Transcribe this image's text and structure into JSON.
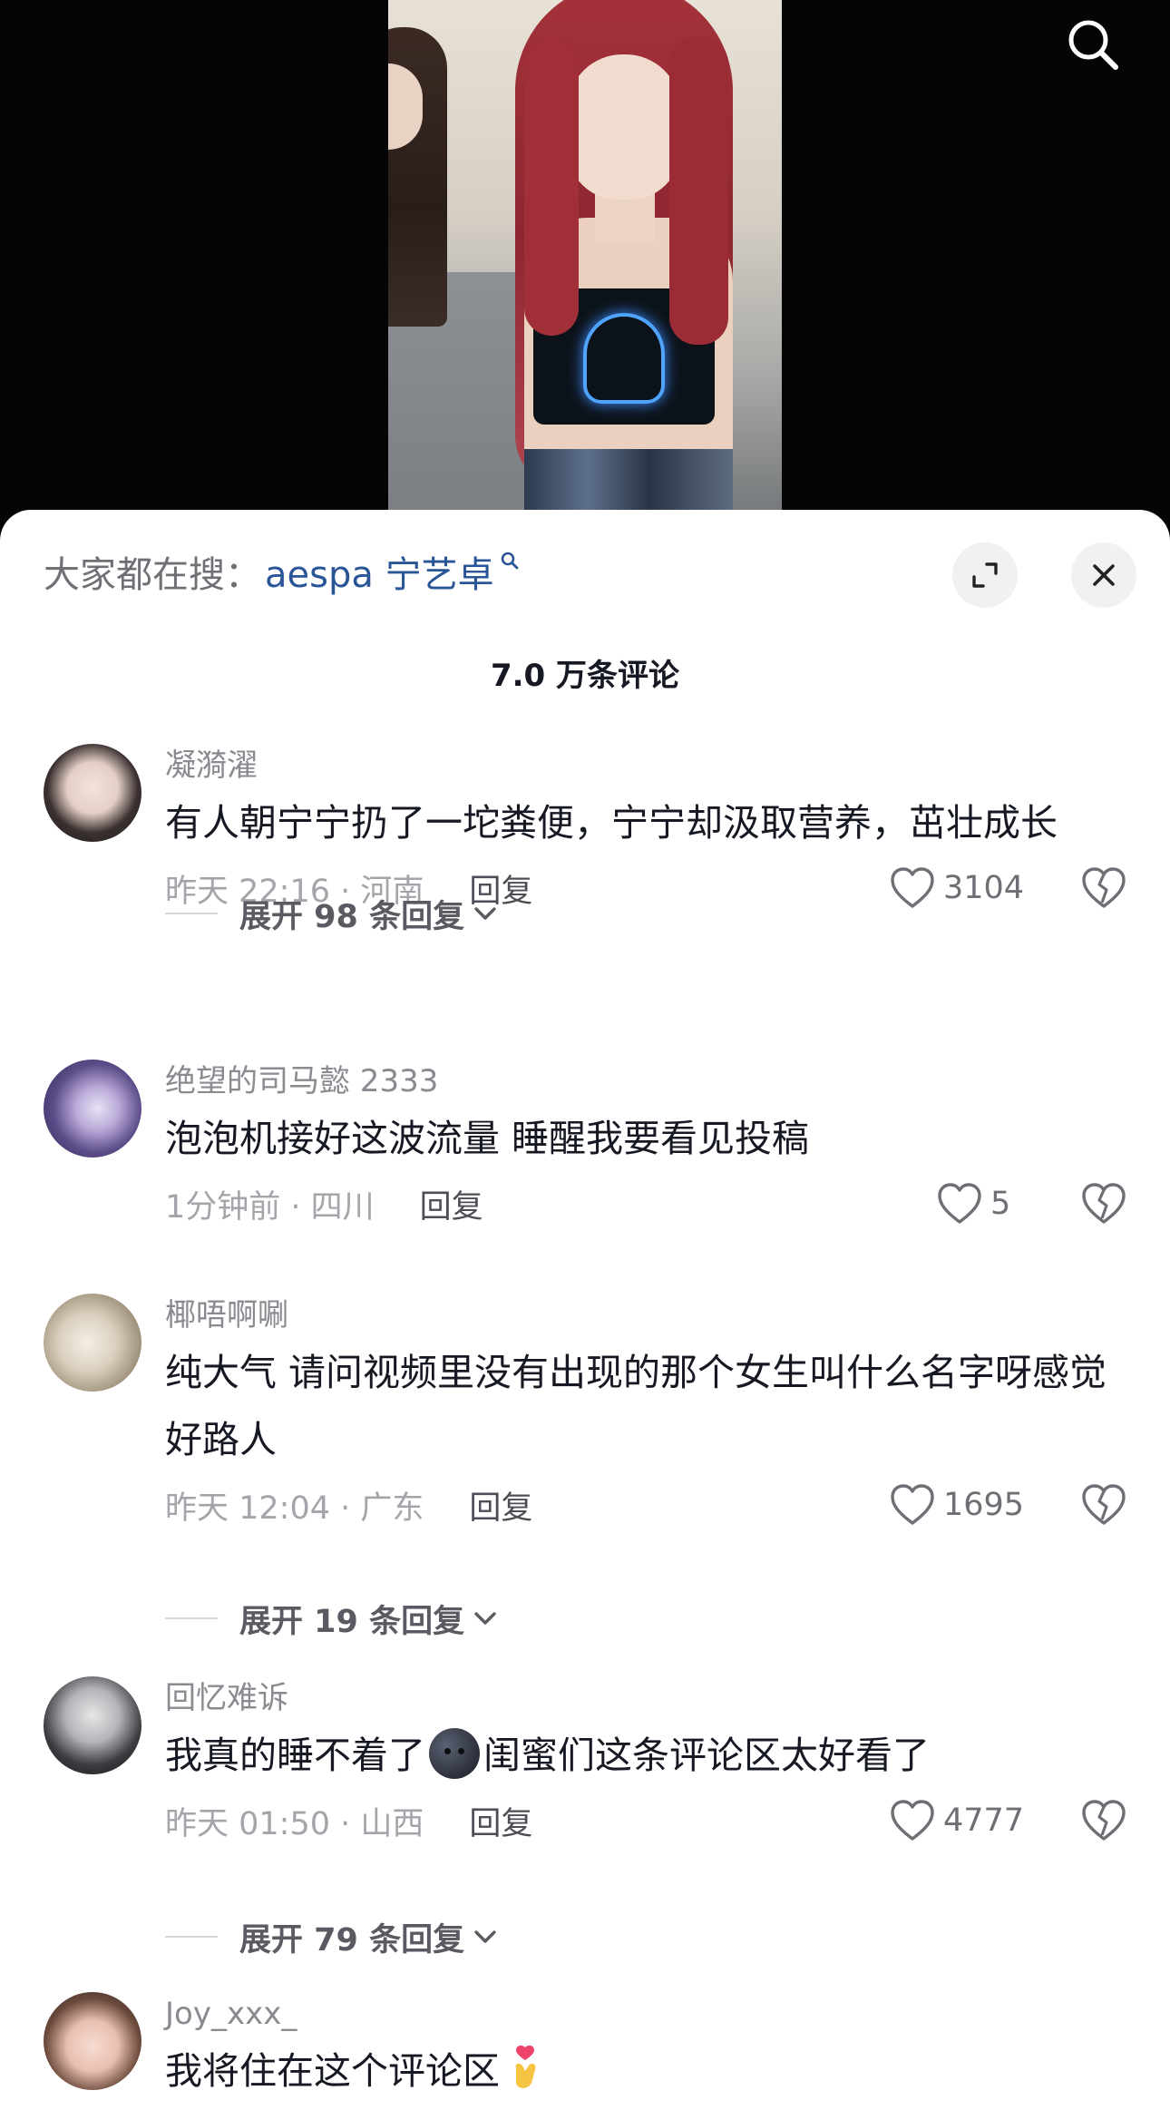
{
  "video": {},
  "sheet": {
    "hot_search_prefix": "大家都在搜：",
    "hot_search_query": "aespa 宁艺卓",
    "comment_count": "7.0 万条评论"
  },
  "comments": [
    {
      "username": "凝漪濯",
      "text": "有人朝宁宁扔了一坨粪便，宁宁却汲取营养，茁壮成长",
      "time_location": "昨天 22:16 · 河南",
      "reply_label": "回复",
      "likes": "3104",
      "expand_label": "展开 98 条回复"
    },
    {
      "username": "绝望的司马懿 2333",
      "text": "泡泡机接好这波流量 睡醒我要看见投稿",
      "time_location": "1分钟前 · 四川",
      "reply_label": "回复",
      "likes": "5"
    },
    {
      "username": "椰唔啊唰",
      "text": "纯大气 请问视频里没有出现的那个女生叫什么名字呀感觉好路人",
      "time_location": "昨天 12:04 · 广东",
      "reply_label": "回复",
      "likes": "1695",
      "expand_label": "展开 19 条回复"
    },
    {
      "username": "回忆难诉",
      "text_before_emoji": "我真的睡不着了",
      "text_after_emoji": "闺蜜们这条评论区太好看了",
      "time_location": "昨天 01:50 · 山西",
      "reply_label": "回复",
      "likes": "4777",
      "expand_label": "展开 79 条回复"
    },
    {
      "username": "Joy_xxx_",
      "text": "我将住在这个评论区"
    }
  ],
  "icons": {
    "search": "search-icon",
    "expand": "expand-icon",
    "close": "close-icon",
    "like": "heart-outline-icon",
    "dislike": "broken-heart-icon",
    "chevron": "chevron-down-icon"
  }
}
